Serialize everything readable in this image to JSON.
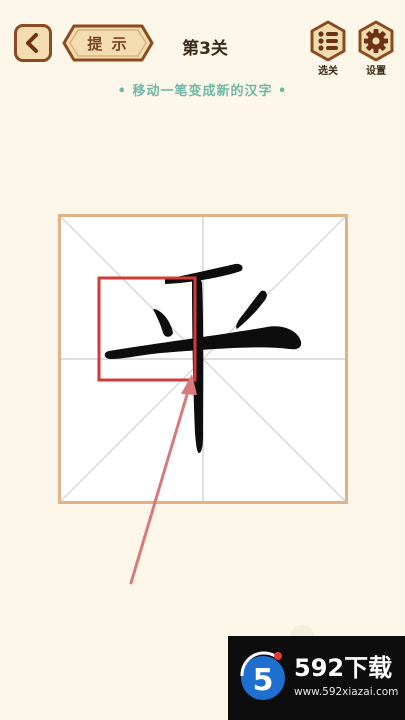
{
  "header": {
    "back_icon": "chevron-left-icon",
    "hint_label": "提 示",
    "level_title": "第3关",
    "level_select_label": "选关",
    "settings_label": "设置"
  },
  "instruction": "• 移动一笔变成新的汉字 •",
  "puzzle": {
    "character": "平",
    "hint": "highlighted-stroke-box-with-arrow"
  },
  "watermark": {
    "logo_text": "5",
    "brand": "592下载",
    "url": "www.592xiazai.com"
  },
  "colors": {
    "background": "#fdf7e9",
    "button_fill": "#f3dcb0",
    "button_border": "#8a4a22",
    "accent_teal": "#6fb7a7",
    "board_border": "#deb388",
    "highlight_red": "#d13a3a"
  }
}
